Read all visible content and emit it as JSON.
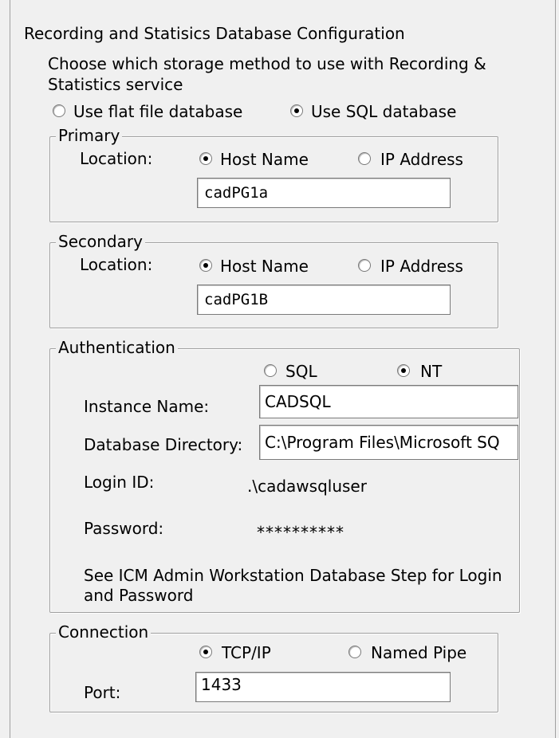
{
  "title": "Recording and Statisics Database Configuration",
  "storage": {
    "prompt": "Choose which storage method to use with Recording & Statistics service",
    "prompt_line1": "Choose which storage method to use with Recording &",
    "prompt_line2": "Statistics service",
    "options": [
      "Use flat file database",
      "Use SQL database"
    ],
    "selected": "Use SQL database"
  },
  "primary": {
    "legend": "Primary",
    "location_label": "Location:",
    "options": [
      "Host Name",
      "IP Address"
    ],
    "selected": "Host Name",
    "value": "cadPG1a"
  },
  "secondary": {
    "legend": "Secondary",
    "location_label": "Location:",
    "options": [
      "Host Name",
      "IP Address"
    ],
    "selected": "Host Name",
    "value": "cadPG1B"
  },
  "authentication": {
    "legend": "Authentication",
    "options": [
      "SQL",
      "NT"
    ],
    "selected": "NT",
    "instance_label": "Instance Name:",
    "instance_value": "CADSQL",
    "directory_label": "Database Directory:",
    "directory_value": "C:\\Program Files\\Microsoft SQ",
    "login_label": "Login ID:",
    "login_value": ".\\cadawsqluser",
    "password_label": "Password:",
    "password_value": "**********",
    "note_line1": "See ICM Admin Workstation Database Step for Login",
    "note_line2": "and Password"
  },
  "connection": {
    "legend": "Connection",
    "options": [
      "TCP/IP",
      "Named Pipe"
    ],
    "selected": "TCP/IP",
    "port_label": "Port:",
    "port_value": "1433"
  },
  "icons": {
    "radio_selected": "radio-selected-icon",
    "radio_unselected": "radio-unselected-icon"
  }
}
